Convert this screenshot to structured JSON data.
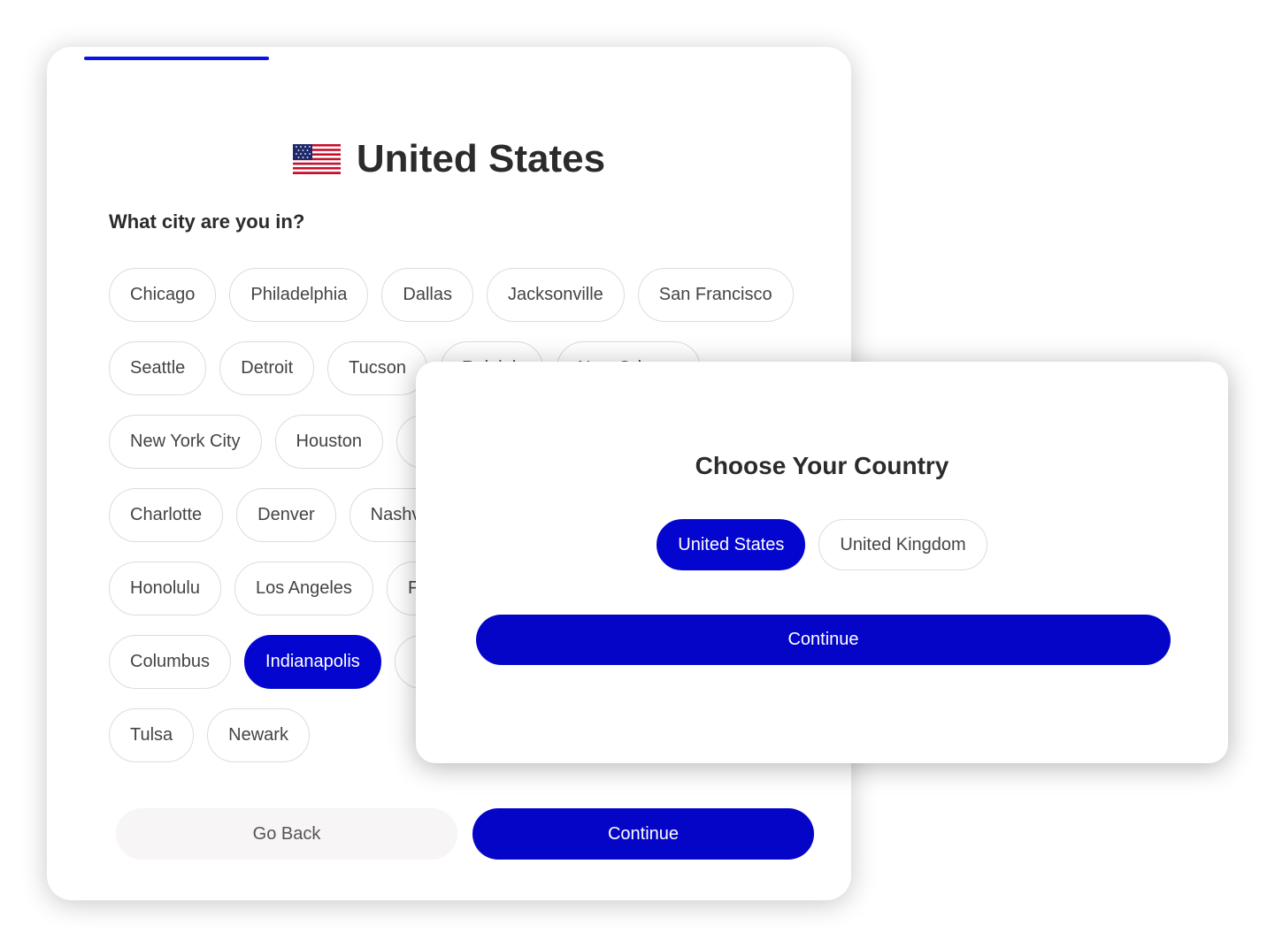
{
  "city_step": {
    "progress_percent": 23,
    "country_title": "United States",
    "flag_icon": "us-flag-icon",
    "question": "What city are you in?",
    "city_rows": [
      [
        {
          "label": "Chicago"
        },
        {
          "label": "Philadelphia"
        },
        {
          "label": "Dallas"
        },
        {
          "label": "Jacksonville"
        },
        {
          "label": "San Francisco"
        }
      ],
      [
        {
          "label": "Seattle"
        },
        {
          "label": "Detroit"
        },
        {
          "label": "Tucson"
        },
        {
          "label": "Raleigh"
        },
        {
          "label": "New Orleans"
        }
      ],
      [
        {
          "label": "New York City"
        },
        {
          "label": "Houston"
        },
        {
          "label": ""
        }
      ],
      [
        {
          "label": "Charlotte"
        },
        {
          "label": "Denver"
        },
        {
          "label": "Nashville"
        }
      ],
      [
        {
          "label": "Honolulu"
        },
        {
          "label": "Los Angeles"
        },
        {
          "label": "F"
        }
      ],
      [
        {
          "label": "Columbus"
        },
        {
          "label": "Indianapolis",
          "selected": true
        },
        {
          "label": ""
        }
      ],
      [
        {
          "label": "Tulsa"
        },
        {
          "label": "Newark"
        }
      ]
    ],
    "go_back_label": "Go Back",
    "continue_label": "Continue"
  },
  "country_modal": {
    "title": "Choose Your Country",
    "options": [
      {
        "label": "United States",
        "selected": true
      },
      {
        "label": "United Kingdom"
      }
    ],
    "continue_label": "Continue"
  },
  "colors": {
    "accent": "#0505c8",
    "chip_border": "#dcdcdc",
    "back_bg": "#f7f5f5"
  }
}
